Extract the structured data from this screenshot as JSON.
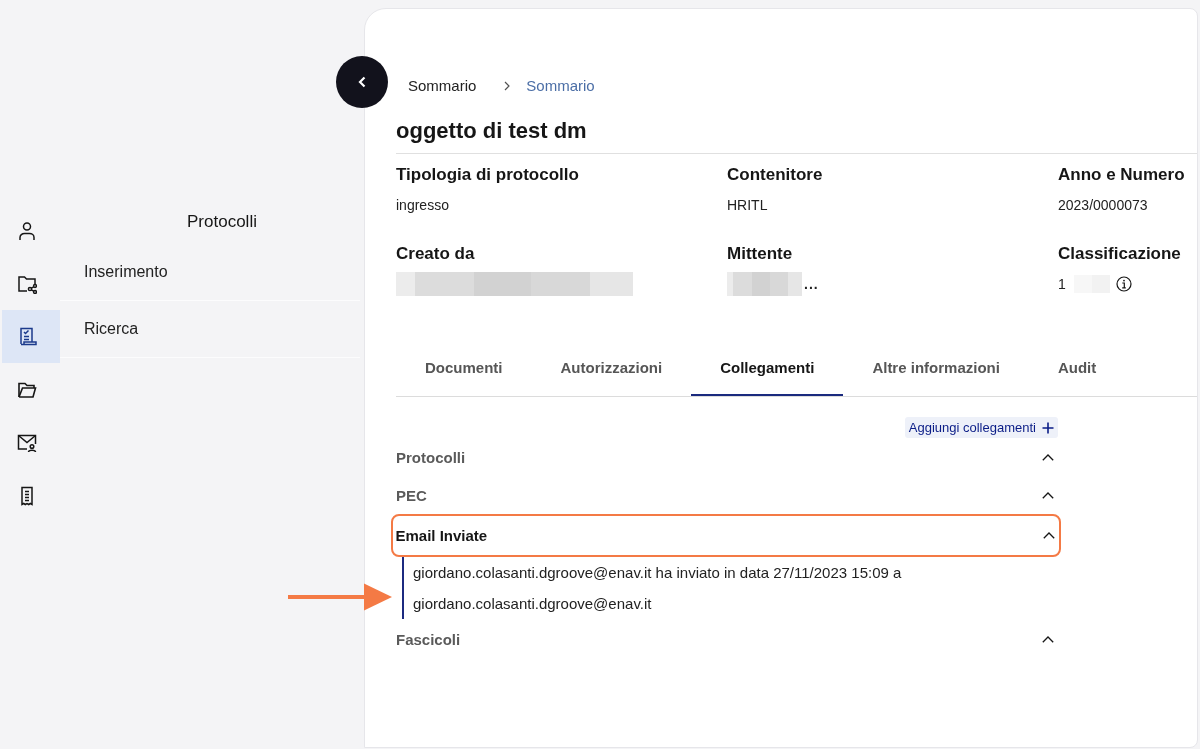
{
  "nav_rail": [
    {
      "selected": false
    },
    {
      "selected": false
    },
    {
      "selected": true
    },
    {
      "selected": false
    },
    {
      "selected": false
    },
    {
      "selected": false
    }
  ],
  "sidebar": {
    "title": "Protocolli",
    "items": [
      "Inserimento",
      "Ricerca"
    ]
  },
  "breadcrumb": [
    {
      "label": "Sommario",
      "current": false
    },
    {
      "label": "Sommario",
      "current": true
    }
  ],
  "title": "oggetto di test dm",
  "fields": [
    {
      "label": "Tipologia di protocollo",
      "parts": [
        {
          "kind": "text",
          "text": "ingresso"
        }
      ]
    },
    {
      "label": "Contenitore",
      "parts": [
        {
          "kind": "text",
          "text": "HRITL"
        }
      ]
    },
    {
      "label": "Anno e Numero",
      "parts": [
        {
          "kind": "text",
          "text": "2023/0000073"
        }
      ]
    },
    {
      "label": "Creato da",
      "parts": [
        {
          "kind": "redacted"
        }
      ]
    },
    {
      "label": "Mittente",
      "parts": [
        {
          "kind": "redacted"
        },
        {
          "kind": "text",
          "text": "..."
        }
      ]
    },
    {
      "label": "Classificazione",
      "parts": [
        {
          "kind": "text",
          "text": "1"
        },
        {
          "kind": "redacted"
        },
        {
          "kind": "info"
        }
      ]
    }
  ],
  "tabs": [
    {
      "label": "Documenti",
      "selected": false
    },
    {
      "label": "Autorizzazioni",
      "selected": false
    },
    {
      "label": "Collegamenti",
      "selected": true
    },
    {
      "label": "Altre informazioni",
      "selected": false
    },
    {
      "label": "Audit",
      "selected": false
    }
  ],
  "add_links_button": {
    "label": "Aggiungi collegamenti"
  },
  "sections": [
    {
      "title": "Protocolli",
      "active": false,
      "highlighted": false
    },
    {
      "title": "PEC",
      "active": false,
      "highlighted": false
    },
    {
      "title": "Email Inviate",
      "active": true,
      "highlighted": true,
      "entries": [
        "giordano.colasanti.dgroove@enav.it ha inviato in data 27/11/2023 15:09 a giordano.colasanti.dgroove@enav.it"
      ]
    },
    {
      "title": "Fascicoli",
      "active": false,
      "highlighted": false
    }
  ],
  "pointer_arrow": true
}
